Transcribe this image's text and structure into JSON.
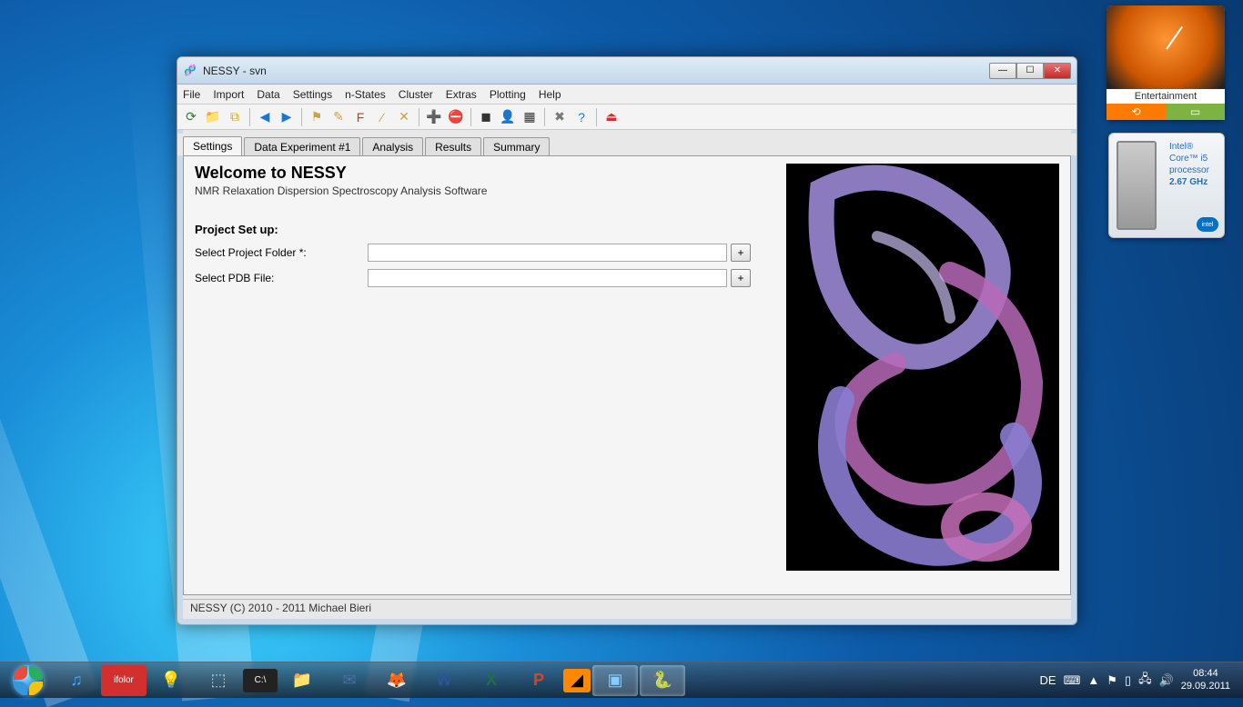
{
  "window": {
    "title": "NESSY - svn",
    "menus": [
      "File",
      "Import",
      "Data",
      "Settings",
      "n-States",
      "Cluster",
      "Extras",
      "Plotting",
      "Help"
    ],
    "tabs": [
      "Settings",
      "Data Experiment #1",
      "Analysis",
      "Results",
      "Summary"
    ],
    "activeTab": 0,
    "welcome": "Welcome to NESSY",
    "subtitle": "NMR Relaxation Dispersion Spectroscopy Analysis Software",
    "sectionTitle": "Project Set up:",
    "fields": {
      "projectFolderLabel": "Select Project Folder *:",
      "projectFolderValue": "",
      "pdbLabel": "Select PDB File:",
      "pdbValue": "",
      "browseLabel": "+"
    },
    "status": "NESSY (C) 2010 - 2011 Michael Bieri"
  },
  "toolbarIcons": [
    {
      "name": "refresh-icon",
      "glyph": "⟳",
      "color": "#2e7d32"
    },
    {
      "name": "folder-icon",
      "glyph": "📁",
      "color": "#caa43a"
    },
    {
      "name": "copy-icon",
      "glyph": "⧉",
      "color": "#caa43a"
    },
    {
      "name": "sep"
    },
    {
      "name": "back-icon",
      "glyph": "◀",
      "color": "#1976d2"
    },
    {
      "name": "forward-icon",
      "glyph": "▶",
      "color": "#1976d2"
    },
    {
      "name": "sep"
    },
    {
      "name": "flag-icon",
      "glyph": "⚑",
      "color": "#caa43a"
    },
    {
      "name": "marker-icon",
      "glyph": "✎",
      "color": "#caa43a"
    },
    {
      "name": "f-icon",
      "glyph": "F",
      "color": "#d32f2f"
    },
    {
      "name": "line-icon",
      "glyph": "∕",
      "color": "#caa43a"
    },
    {
      "name": "x-icon",
      "glyph": "✕",
      "color": "#caa43a"
    },
    {
      "name": "sep"
    },
    {
      "name": "add-icon",
      "glyph": "➕",
      "color": "#2e7d32"
    },
    {
      "name": "remove-icon",
      "glyph": "⛔",
      "color": "#d32f2f"
    },
    {
      "name": "sep"
    },
    {
      "name": "stop-icon",
      "glyph": "◼",
      "color": "#333"
    },
    {
      "name": "user-icon",
      "glyph": "👤",
      "color": "#333"
    },
    {
      "name": "grid-icon",
      "glyph": "▦",
      "color": "#333"
    },
    {
      "name": "sep"
    },
    {
      "name": "tools-icon",
      "glyph": "✖",
      "color": "#777"
    },
    {
      "name": "help-icon",
      "glyph": "?",
      "color": "#1976d2"
    },
    {
      "name": "sep"
    },
    {
      "name": "exit-icon",
      "glyph": "⏏",
      "color": "#d32f2f"
    }
  ],
  "gadgets": {
    "entertainment": "Entertainment",
    "cpu": {
      "l1": "Intel®",
      "l2": "Core™ i5",
      "l3": "processor",
      "l4": "2.67 GHz",
      "brand": "intel"
    }
  },
  "taskbar": {
    "lang": "DE",
    "time": "08:44",
    "date": "29.09.2011"
  }
}
